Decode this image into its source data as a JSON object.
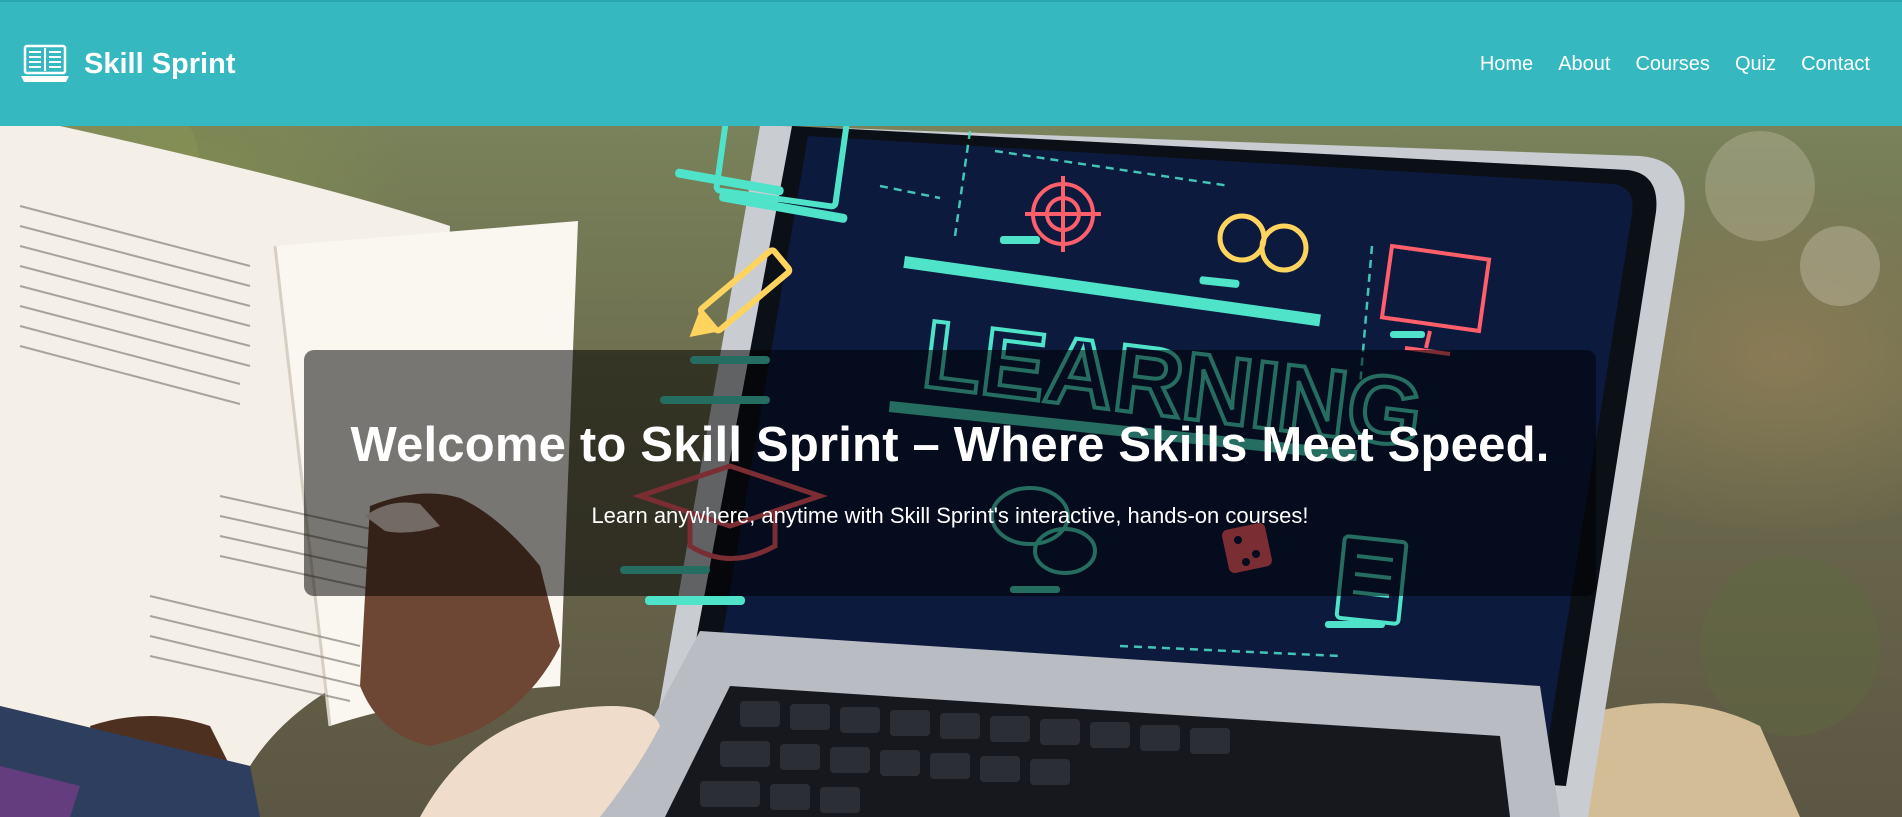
{
  "brand": {
    "name": "Skill Sprint",
    "icon": "laptop-book-icon"
  },
  "nav": {
    "items": [
      {
        "label": "Home"
      },
      {
        "label": "About"
      },
      {
        "label": "Courses"
      },
      {
        "label": "Quiz"
      },
      {
        "label": "Contact"
      }
    ]
  },
  "hero": {
    "title": "Welcome to Skill Sprint – Where Skills Meet Speed.",
    "subtitle": "Learn anywhere, anytime with Skill Sprint's interactive, hands-on courses!",
    "image_screen_text": "LEARNING"
  },
  "colors": {
    "navbar": "#35b8c0",
    "text": "#ffffff",
    "overlay": "rgba(0,0,0,0.52)"
  }
}
